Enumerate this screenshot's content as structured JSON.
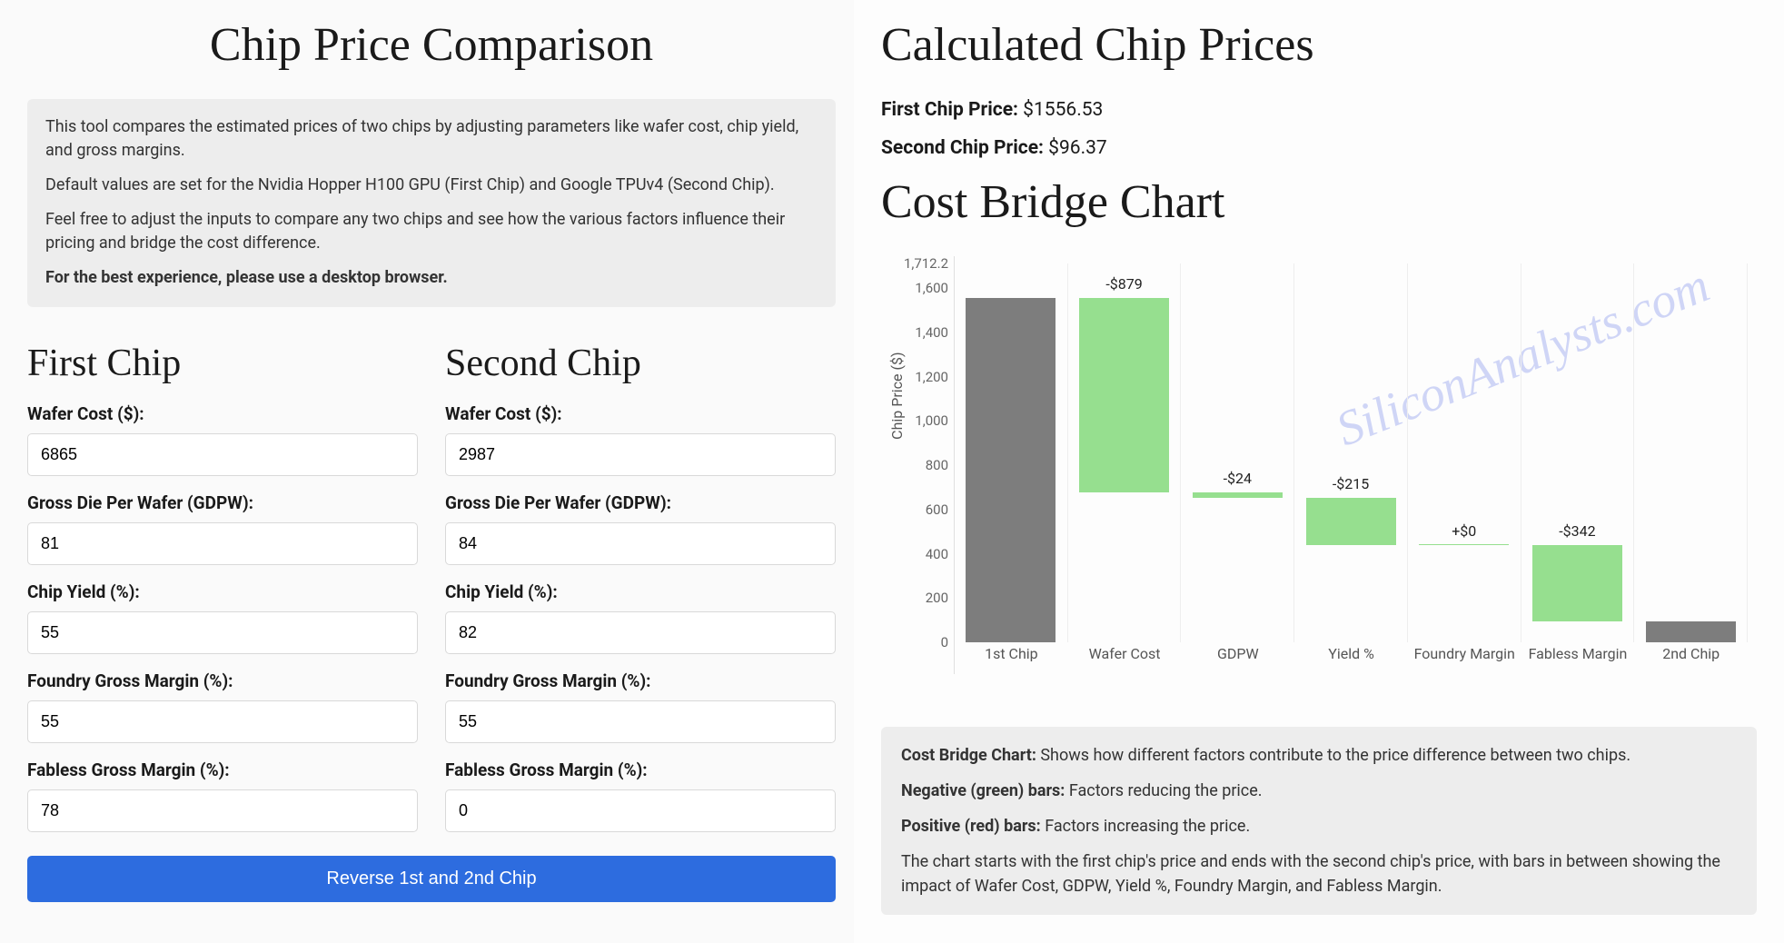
{
  "left": {
    "title": "Chip Price Comparison",
    "info": {
      "p1": "This tool compares the estimated prices of two chips by adjusting parameters like wafer cost, chip yield, and gross margins.",
      "p2": "Default values are set for the Nvidia Hopper H100 GPU (First Chip) and Google TPUv4 (Second Chip).",
      "p3": "Feel free to adjust the inputs to compare any two chips and see how the various factors influence their pricing and bridge the cost difference.",
      "p4": "For the best experience, please use a desktop browser."
    },
    "first": {
      "heading": "First Chip",
      "wafer_label": "Wafer Cost ($):",
      "wafer_value": "6865",
      "gdpw_label": "Gross Die Per Wafer (GDPW):",
      "gdpw_value": "81",
      "yield_label": "Chip Yield (%):",
      "yield_value": "55",
      "foundry_label": "Foundry Gross Margin (%):",
      "foundry_value": "55",
      "fabless_label": "Fabless Gross Margin (%):",
      "fabless_value": "78"
    },
    "second": {
      "heading": "Second Chip",
      "wafer_label": "Wafer Cost ($):",
      "wafer_value": "2987",
      "gdpw_label": "Gross Die Per Wafer (GDPW):",
      "gdpw_value": "84",
      "yield_label": "Chip Yield (%):",
      "yield_value": "82",
      "foundry_label": "Foundry Gross Margin (%):",
      "foundry_value": "55",
      "fabless_label": "Fabless Gross Margin (%):",
      "fabless_value": "0"
    },
    "reverse_label": "Reverse 1st and 2nd Chip"
  },
  "right": {
    "prices_heading": "Calculated Chip Prices",
    "first_price_label": "First Chip Price:",
    "first_price_value": " $1556.53",
    "second_price_label": "Second Chip Price:",
    "second_price_value": " $96.37",
    "chart_heading": "Cost Bridge Chart",
    "watermark": "SiliconAnalysts.com",
    "ylabel": "Chip Price ($)",
    "legend": {
      "l1a": "Cost Bridge Chart:",
      "l1b": " Shows how different factors contribute to the price difference between two chips.",
      "l2a": "Negative (green) bars:",
      "l2b": " Factors reducing the price.",
      "l3a": "Positive (red) bars:",
      "l3b": " Factors increasing the price.",
      "l4": "The chart starts with the first chip's price and ends with the second chip's price, with bars in between showing the impact of Wafer Cost, GDPW, Yield %, Foundry Margin, and Fabless Margin."
    }
  },
  "chart_data": {
    "type": "bar",
    "title": "Cost Bridge Chart",
    "ylabel": "Chip Price ($)",
    "ylim": [
      0,
      1712.2
    ],
    "yticks": [
      0,
      200,
      400,
      600,
      800,
      1000,
      1200,
      1400,
      1600,
      1712.2
    ],
    "categories": [
      "1st Chip",
      "Wafer Cost",
      "GDPW",
      "Yield %",
      "Foundry Margin",
      "Fabless Margin",
      "2nd Chip"
    ],
    "bars": [
      {
        "name": "1st Chip",
        "kind": "total",
        "start": 0,
        "end": 1556.53,
        "label": "",
        "color": "gray"
      },
      {
        "name": "Wafer Cost",
        "kind": "delta",
        "start": 1556.53,
        "end": 677.53,
        "label": "-$879",
        "color": "green"
      },
      {
        "name": "GDPW",
        "kind": "delta",
        "start": 677.53,
        "end": 653.53,
        "label": "-$24",
        "color": "green"
      },
      {
        "name": "Yield %",
        "kind": "delta",
        "start": 653.53,
        "end": 438.53,
        "label": "-$215",
        "color": "green"
      },
      {
        "name": "Foundry Margin",
        "kind": "delta",
        "start": 438.53,
        "end": 438.53,
        "label": "+$0",
        "color": "green"
      },
      {
        "name": "Fabless Margin",
        "kind": "delta",
        "start": 438.53,
        "end": 96.37,
        "label": "-$342",
        "color": "green"
      },
      {
        "name": "2nd Chip",
        "kind": "total",
        "start": 0,
        "end": 96.37,
        "label": "",
        "color": "gray"
      }
    ]
  }
}
